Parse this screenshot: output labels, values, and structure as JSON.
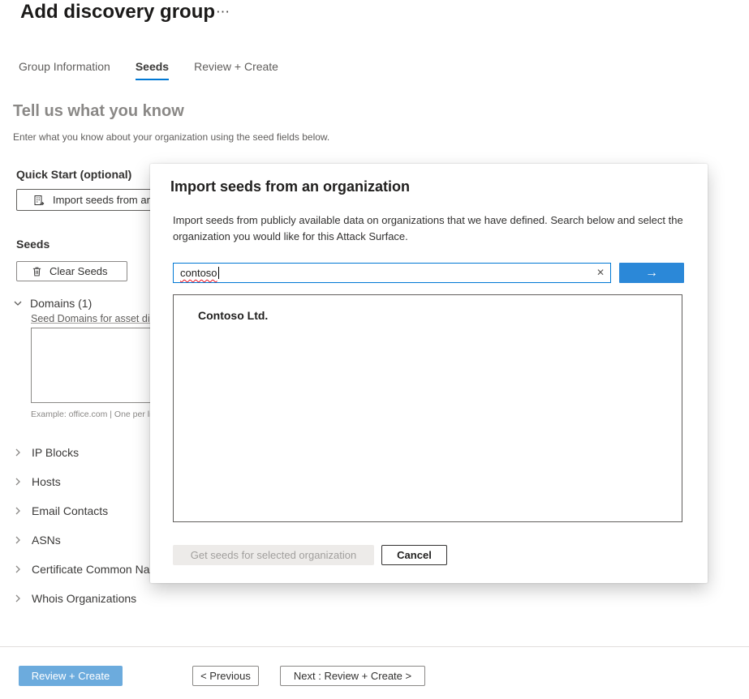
{
  "page": {
    "title": "Add discovery group"
  },
  "icons": {
    "more_options": "⋯",
    "clear_input": "✕",
    "submit_arrow": "→"
  },
  "tabs": [
    {
      "label": "Group Information"
    },
    {
      "label": "Seeds"
    },
    {
      "label": "Review + Create"
    }
  ],
  "content": {
    "heading": "Tell us what you know",
    "subheading": "Enter what you know about your organization using the seed fields below.",
    "quick_start_label": "Quick Start (optional)",
    "import_button_label": "Import seeds from an organization",
    "seeds_label": "Seeds",
    "clear_seeds_label": "Clear Seeds",
    "domains": {
      "label": "Domains (1)",
      "field_label": "Seed Domains for asset discovery",
      "textarea_value": "",
      "example": "Example: office.com | One per line"
    },
    "collapsed_sections": [
      {
        "label": "IP Blocks"
      },
      {
        "label": "Hosts"
      },
      {
        "label": "Email Contacts"
      },
      {
        "label": "ASNs"
      },
      {
        "label": "Certificate Common Names"
      },
      {
        "label": "Whois Organizations"
      }
    ]
  },
  "modal": {
    "title": "Import seeds from an organization",
    "description": "Import seeds from publicly available data on organizations that we have defined. Search below and select the organization you would like for this Attack Surface.",
    "search_value": "contoso",
    "results": [
      {
        "name": "Contoso Ltd."
      }
    ],
    "get_seeds_label": "Get seeds for selected organization",
    "cancel_label": "Cancel"
  },
  "footer": {
    "review_create_label": "Review + Create",
    "previous_label": "< Previous",
    "next_label": "Next : Review + Create >"
  },
  "colors": {
    "accent": "#0078d4",
    "primary_button": "#6cabdd",
    "arrow_button": "#2b88d8",
    "spellcheck_underline": "#e81123",
    "disabled_bg": "#edebe9",
    "disabled_text": "#a19f9d"
  }
}
